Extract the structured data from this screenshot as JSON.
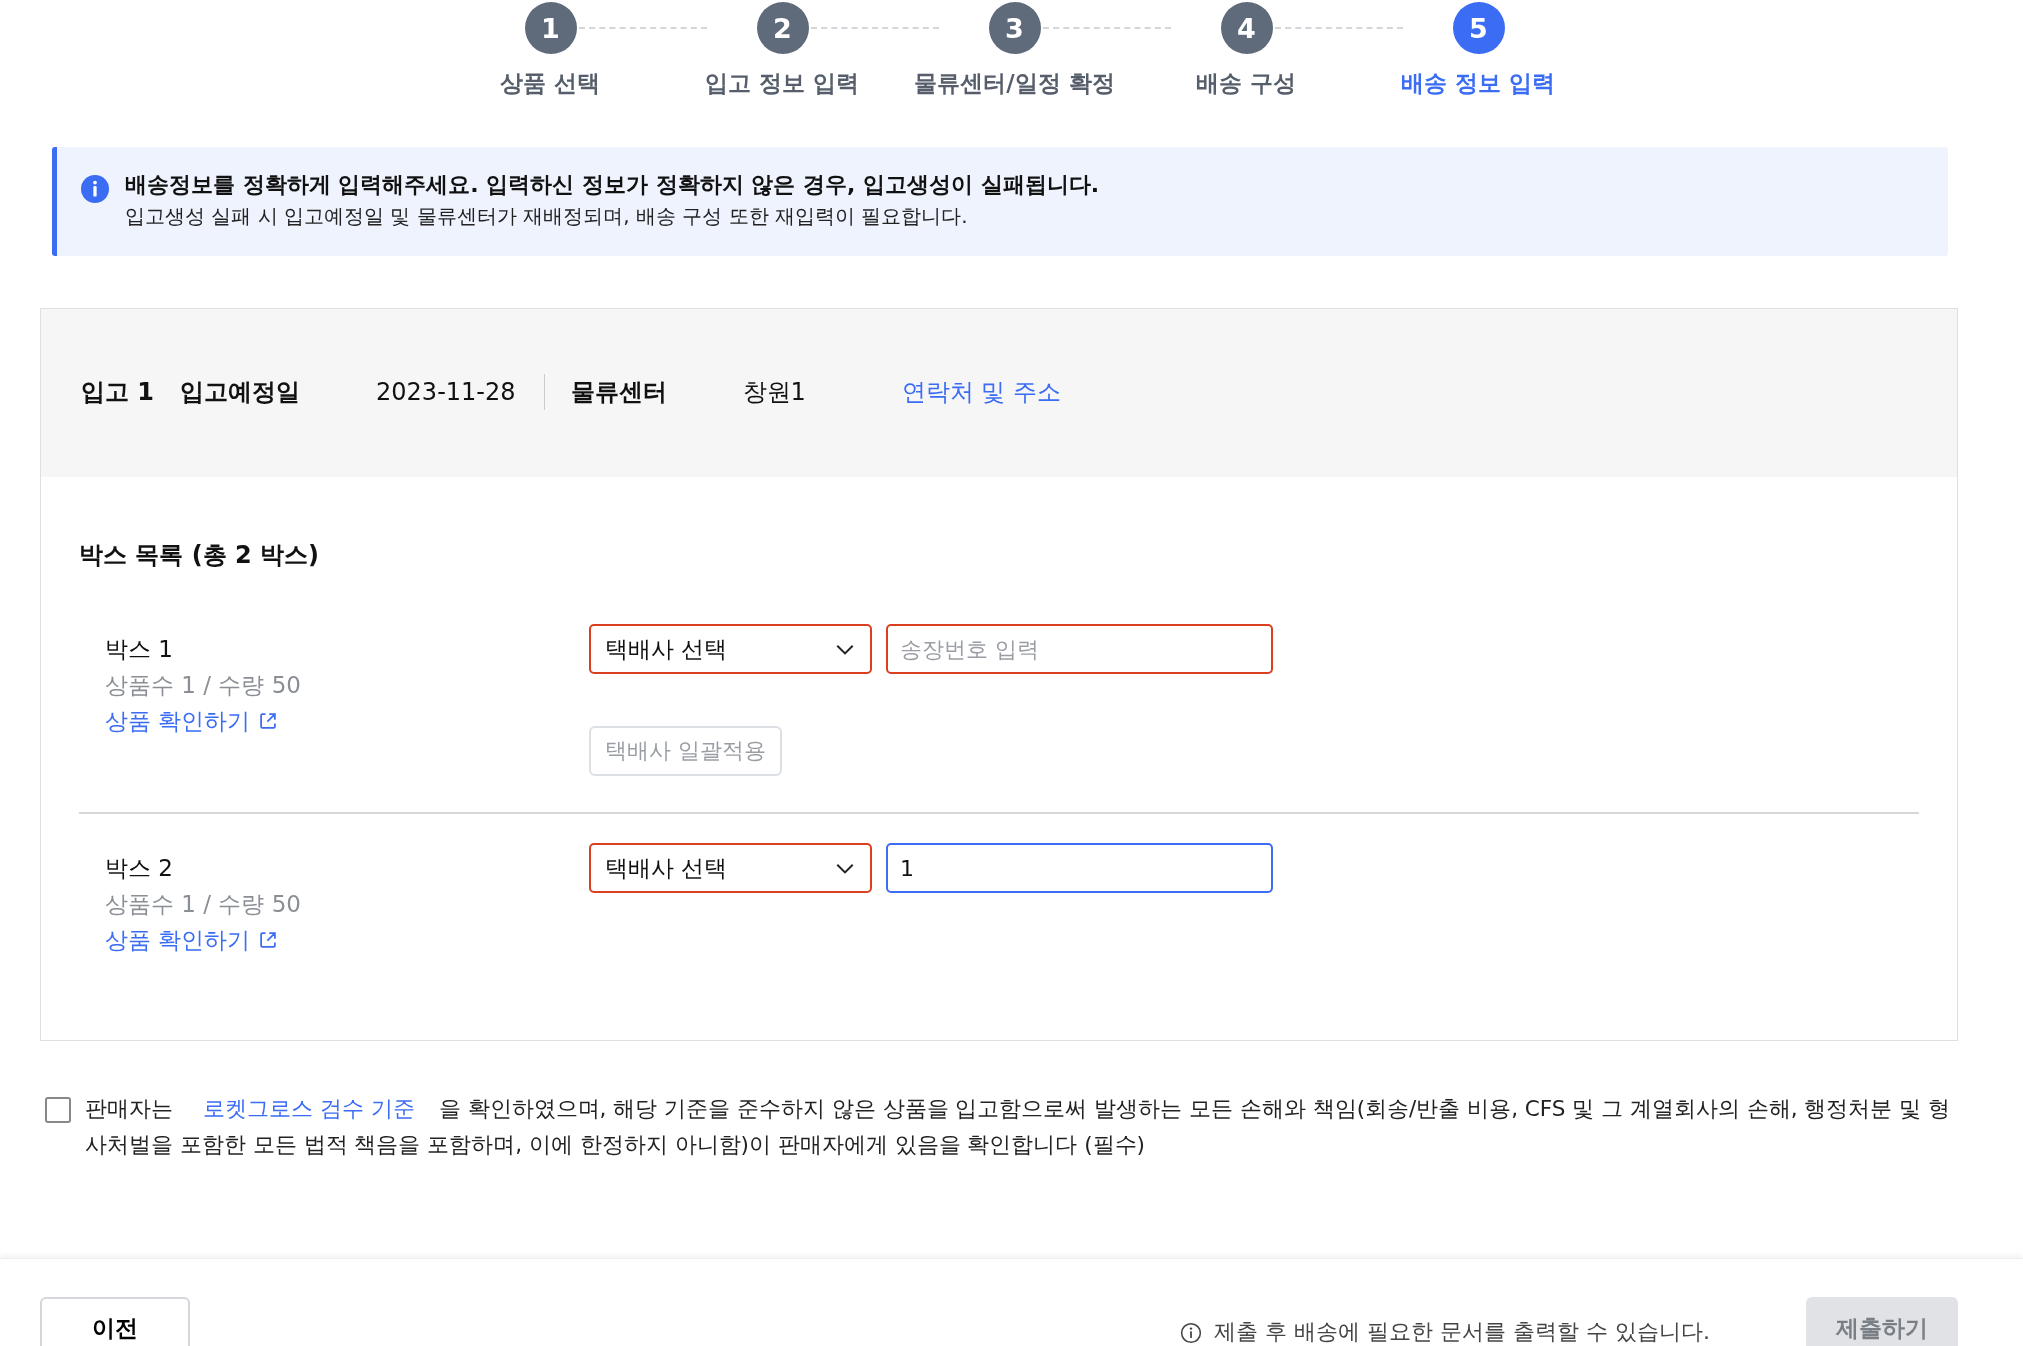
{
  "steps": [
    {
      "number": "1",
      "label": "상품 선택",
      "selected": false
    },
    {
      "number": "2",
      "label": "입고 정보 입력",
      "selected": false
    },
    {
      "number": "3",
      "label": "물류센터/일정 확정",
      "selected": false
    },
    {
      "number": "4",
      "label": "배송 구성",
      "selected": false
    },
    {
      "number": "5",
      "label": "배송 정보 입력",
      "selected": true
    }
  ],
  "notice": {
    "title": "배송정보를 정확하게 입력해주세요. 입력하신 정보가 정확하지 않은 경우, 입고생성이 실패됩니다.",
    "body": "입고생성 실패 시 입고예정일 및 물류센터가 재배정되며, 배송 구성 또한 재입력이 필요합니다."
  },
  "inbound": {
    "label": "입고 1",
    "date_label": "입고예정일",
    "date": "2023-11-28",
    "center_label": "물류센터",
    "center": "창원1",
    "contact_link": "연락처 및 주소"
  },
  "box_list": {
    "title": "박스 목록 (총 2 박스)",
    "boxes": [
      {
        "name": "박스 1",
        "summary": "상품수 1 / 수량 50",
        "link": "상품 확인하기",
        "carrier_select": {
          "value": "택배사 선택",
          "error": true
        },
        "invoice_field": {
          "placeholder": "송장번호 입력",
          "error": true
        },
        "bulk_apply": {
          "label": "택배사 일괄적용",
          "disabled": true
        }
      },
      {
        "name": "박스 2",
        "summary": "상품수 1 / 수량 50",
        "link": "상품 확인하기",
        "carrier_select": {
          "value": "택배사 선택",
          "error": true
        },
        "invoice_field": {
          "value": "1",
          "error": false,
          "focused": true
        }
      }
    ]
  },
  "agreement": {
    "checked": false,
    "before": "판매자는",
    "link": "로켓그로스 검수 기준",
    "after": "을 확인하였으며, 해당 기준을 준수하지 않은 상품을 입고함으로써 발생하는 모든 손해와 책임(회송/반출 비용, CFS 및 그 계열회사의 손해, 행정처분 및 형사처벌을 포함한 모든 법적 책음을 포함하며, 이에 한정하지 아니함)이 판매자에게 있음을 확인합니다 (필수)"
  },
  "footer": {
    "prev_button": "이전",
    "hint": "제출 후 배송에 필요한 문서를 출력할 수 있습니다.",
    "submit_button": {
      "label": "제출하기",
      "disabled": true
    }
  }
}
